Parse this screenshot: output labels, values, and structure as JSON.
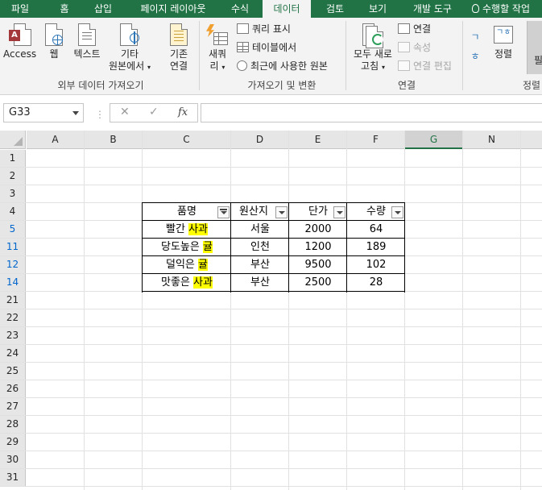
{
  "tabs": [
    "파일",
    "홈",
    "삽입",
    "페이지 레이아웃",
    "수식",
    "데이터",
    "검토",
    "보기",
    "개발 도구",
    "수행할 작업"
  ],
  "active_tab": "데이터",
  "ribbon": {
    "external_data": {
      "access": "Access",
      "web": "웹",
      "text": "텍스트",
      "other_line1": "기타",
      "other_line2": "원본에서",
      "existing_line1": "기존",
      "existing_line2": "연결",
      "group_label": "외부 데이터 가져오기"
    },
    "get_transform": {
      "new_query_line1": "새쿼",
      "new_query_line2": "리",
      "show_queries": "쿼리 표시",
      "from_table": "테이블에서",
      "recent_sources": "최근에 사용한 원본",
      "group_label": "가져오기 및 변환"
    },
    "connections": {
      "refresh_line1": "모두 새로",
      "refresh_line2": "고침",
      "connections": "연결",
      "properties": "속성",
      "edit_links": "연결 편집",
      "group_label": "연결"
    },
    "sort_filter": {
      "sort": "정렬",
      "sort_az_top": "ㄱ",
      "sort_az_bottom": "ㅎ",
      "group_label": "정렬",
      "filter_partial": "필"
    }
  },
  "formula_bar": {
    "name_box": "G33",
    "cancel": "✕",
    "enter": "✓",
    "fx": "fx",
    "formula": ""
  },
  "columns": [
    "A",
    "B",
    "C",
    "D",
    "E",
    "F",
    "G",
    "N"
  ],
  "selected_column": "G",
  "rows": [
    "1",
    "2",
    "3",
    "4",
    "5",
    "11",
    "12",
    "14",
    "21",
    "22",
    "23",
    "24",
    "25",
    "26",
    "27",
    "28",
    "29",
    "30",
    "31"
  ],
  "filtered_rows": [
    "5",
    "11",
    "12",
    "14"
  ],
  "table": {
    "headers": [
      "품명",
      "원산지",
      "단가",
      "수량"
    ],
    "rows": [
      {
        "name_pre": "빨간 ",
        "name_hl": "사과",
        "origin": "서울",
        "price": "2000",
        "qty": "64"
      },
      {
        "name_pre": "당도높은 ",
        "name_hl": "귤",
        "origin": "인천",
        "price": "1200",
        "qty": "189"
      },
      {
        "name_pre": "덜익은 ",
        "name_hl": "귤",
        "origin": "부산",
        "price": "9500",
        "qty": "102"
      },
      {
        "name_pre": "맛좋은 ",
        "name_hl": "사과",
        "origin": "부산",
        "price": "2500",
        "qty": "28"
      }
    ]
  },
  "colors": {
    "excel_green": "#217346",
    "highlight": "#ffff00",
    "filtered_row_number": "#0066cc"
  }
}
